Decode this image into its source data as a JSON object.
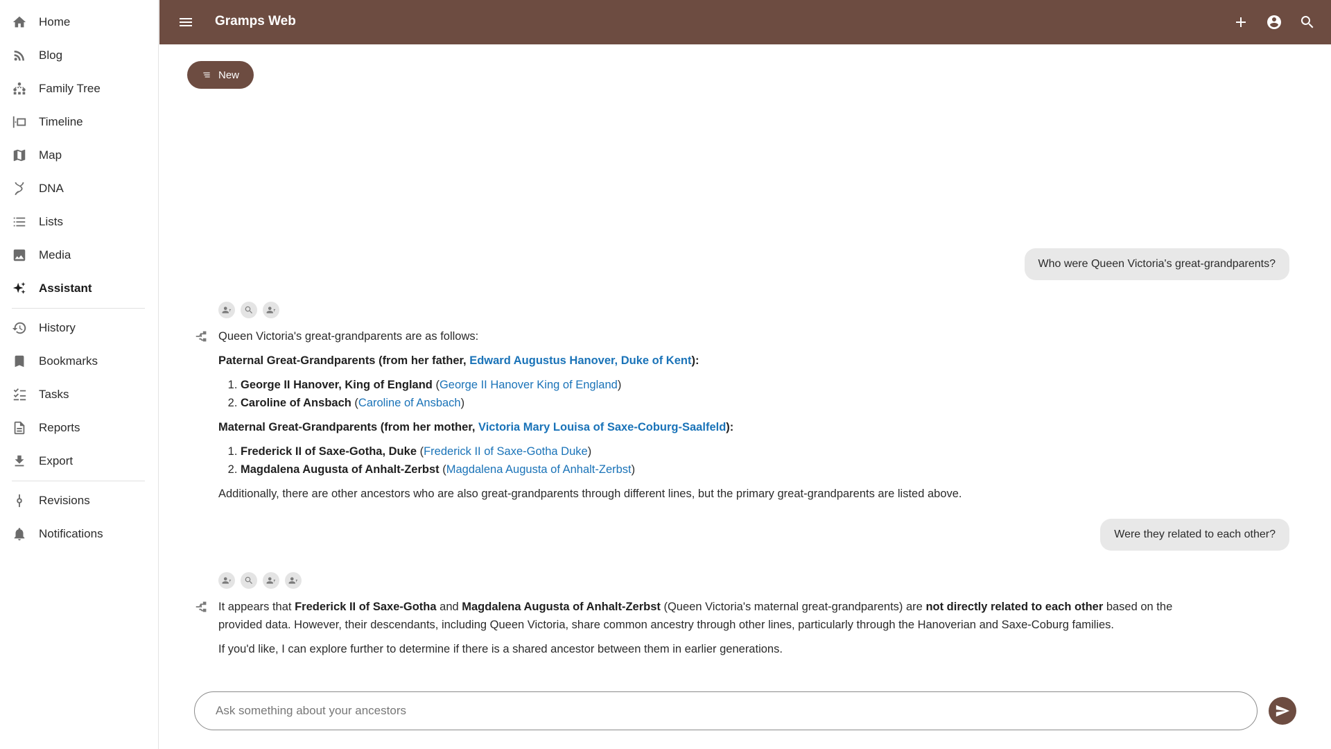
{
  "app": {
    "title": "Gramps Web"
  },
  "sidebar": {
    "items": [
      {
        "label": "Home",
        "icon": "home-icon"
      },
      {
        "label": "Blog",
        "icon": "rss-icon"
      },
      {
        "label": "Family Tree",
        "icon": "family-tree-icon"
      },
      {
        "label": "Timeline",
        "icon": "timeline-icon"
      },
      {
        "label": "Map",
        "icon": "map-icon"
      },
      {
        "label": "DNA",
        "icon": "dna-icon"
      },
      {
        "label": "Lists",
        "icon": "list-icon"
      },
      {
        "label": "Media",
        "icon": "image-icon"
      },
      {
        "label": "Assistant",
        "icon": "sparkle-icon",
        "active": true
      },
      {
        "label": "History",
        "icon": "history-icon"
      },
      {
        "label": "Bookmarks",
        "icon": "bookmark-icon"
      },
      {
        "label": "Tasks",
        "icon": "checklist-icon"
      },
      {
        "label": "Reports",
        "icon": "report-icon"
      },
      {
        "label": "Export",
        "icon": "download-icon"
      },
      {
        "label": "Revisions",
        "icon": "commit-icon"
      },
      {
        "label": "Notifications",
        "icon": "bell-icon"
      }
    ]
  },
  "toolbar": {
    "new_label": "New"
  },
  "chat": {
    "q1": "Who were Queen Victoria's great-grandparents?",
    "a1": {
      "intro": "Queen Victoria's great-grandparents are as follows:",
      "paternal_prefix": "Paternal Great-Grandparents (from her father, ",
      "paternal_link": "Edward Augustus Hanover, Duke of Kent",
      "paternal_suffix": "):",
      "paternal": [
        {
          "name": "George II Hanover, King of England",
          "link": "George II Hanover King of England"
        },
        {
          "name": "Caroline of Ansbach",
          "link": "Caroline of Ansbach"
        }
      ],
      "maternal_prefix": "Maternal Great-Grandparents (from her mother, ",
      "maternal_link": "Victoria Mary Louisa of Saxe-Coburg-Saalfeld",
      "maternal_suffix": "):",
      "maternal": [
        {
          "name": "Frederick II of Saxe-Gotha, Duke",
          "link": "Frederick II of Saxe-Gotha Duke"
        },
        {
          "name": "Magdalena Augusta of Anhalt-Zerbst",
          "link": "Magdalena Augusta of Anhalt-Zerbst"
        }
      ],
      "closing": "Additionally, there are other ancestors who are also great-grandparents through different lines, but the primary great-grandparents are listed above."
    },
    "q2": "Were they related to each other?",
    "a2": {
      "t1": "It appears that ",
      "b1": "Frederick II of Saxe-Gotha",
      "t2": " and ",
      "b2": "Magdalena Augusta of Anhalt-Zerbst",
      "t3": " (Queen Victoria's maternal great-grandparents) are ",
      "b3": "not directly related to each other",
      "t4": " based on the provided data. However, their descendants, including Queen Victoria, share common ancestry through other lines, particularly through the Hanoverian and Saxe-Coburg families.",
      "p2": "If you'd like, I can explore further to determine if there is a shared ancestor between them in earlier generations."
    }
  },
  "input": {
    "placeholder": "Ask something about your ancestors",
    "value": ""
  },
  "colors": {
    "brand": "#6d4c41",
    "link": "#1a73b8"
  }
}
